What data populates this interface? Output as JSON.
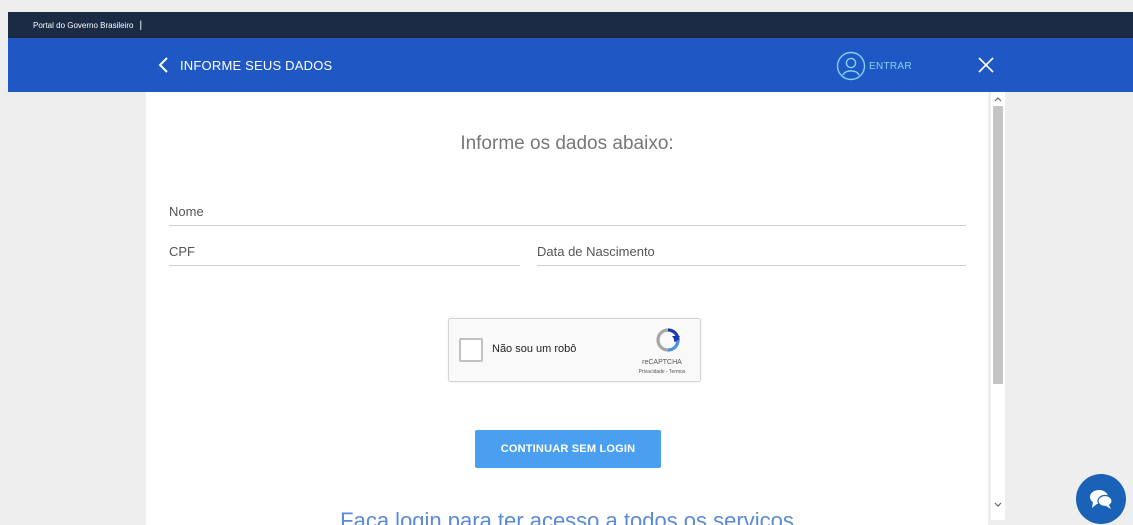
{
  "gov_bar": {
    "portal_label": "Portal do Governo Brasileiro",
    "separator": "|"
  },
  "header": {
    "title": "INFORME SEUS DADOS",
    "login_label": "ENTRAR"
  },
  "form": {
    "heading": "Informe os dados abaixo:",
    "fields": {
      "name_label": "Nome",
      "cpf_label": "CPF",
      "birthdate_label": "Data de Nascimento"
    }
  },
  "recaptcha": {
    "checkbox_label": "Não sou um robô",
    "brand": "reCAPTCHA",
    "links": "Privacidade - Termos"
  },
  "actions": {
    "continue_label": "CONTINUAR SEM LOGIN"
  },
  "teaser": {
    "text": "Faça login para ter acesso a todos os serviços"
  },
  "colors": {
    "gov_bar": "#1b2b45",
    "header": "#1f58c5",
    "accent_login": "#7fd4ee",
    "button": "#4a9ff0",
    "chat": "#1a62b8"
  },
  "icons": {
    "back": "chevron-left-icon",
    "user": "user-circle-icon",
    "close": "close-icon",
    "recaptcha": "recaptcha-logo-icon",
    "chat": "chat-bubbles-icon",
    "scroll_up": "chevron-up-icon",
    "scroll_down": "chevron-down-icon"
  }
}
